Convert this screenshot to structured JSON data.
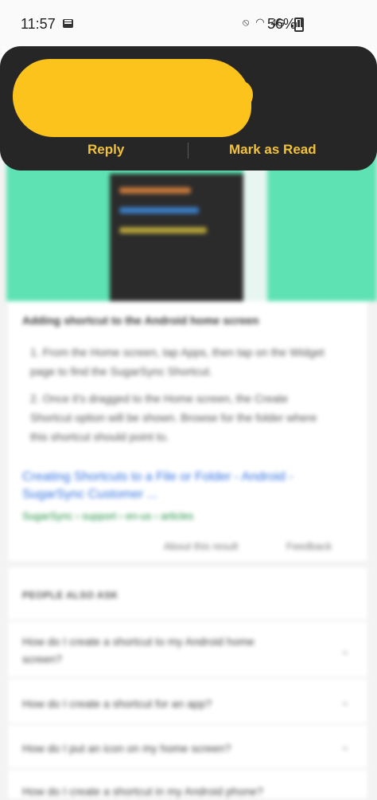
{
  "status_bar": {
    "time": "11:57",
    "lte_label": "4G",
    "battery_percent": "56%"
  },
  "notification": {
    "reply_label": "Reply",
    "mark_read_label": "Mark as Read",
    "accent_color": "#f2c23b",
    "redaction_color": "#fdc31d"
  },
  "result": {
    "snippet_title": "Adding shortcut to the Android home screen",
    "steps": [
      "1. From the Home screen, tap Apps, then tap on the Widget page to find the SugarSync Shortcut.",
      "2. Once it's dragged to the Home screen, the Create Shortcut option will be shown. Browse for the folder where this shortcut should point to."
    ],
    "link_title": "Creating Shortcuts to a File or Folder - Android - SugarSync Customer ...",
    "url": "SugarSync › support › en-us › articles",
    "about_label": "About this result",
    "feedback_label": "Feedback"
  },
  "people_also_ask": {
    "header": "PEOPLE ALSO ASK",
    "questions": [
      "How do I create a shortcut to my Android home screen?",
      "How do I create a shortcut for an app?",
      "How do I put an icon on my home screen?",
      "How do I create a shortcut in my Android phone?"
    ]
  }
}
